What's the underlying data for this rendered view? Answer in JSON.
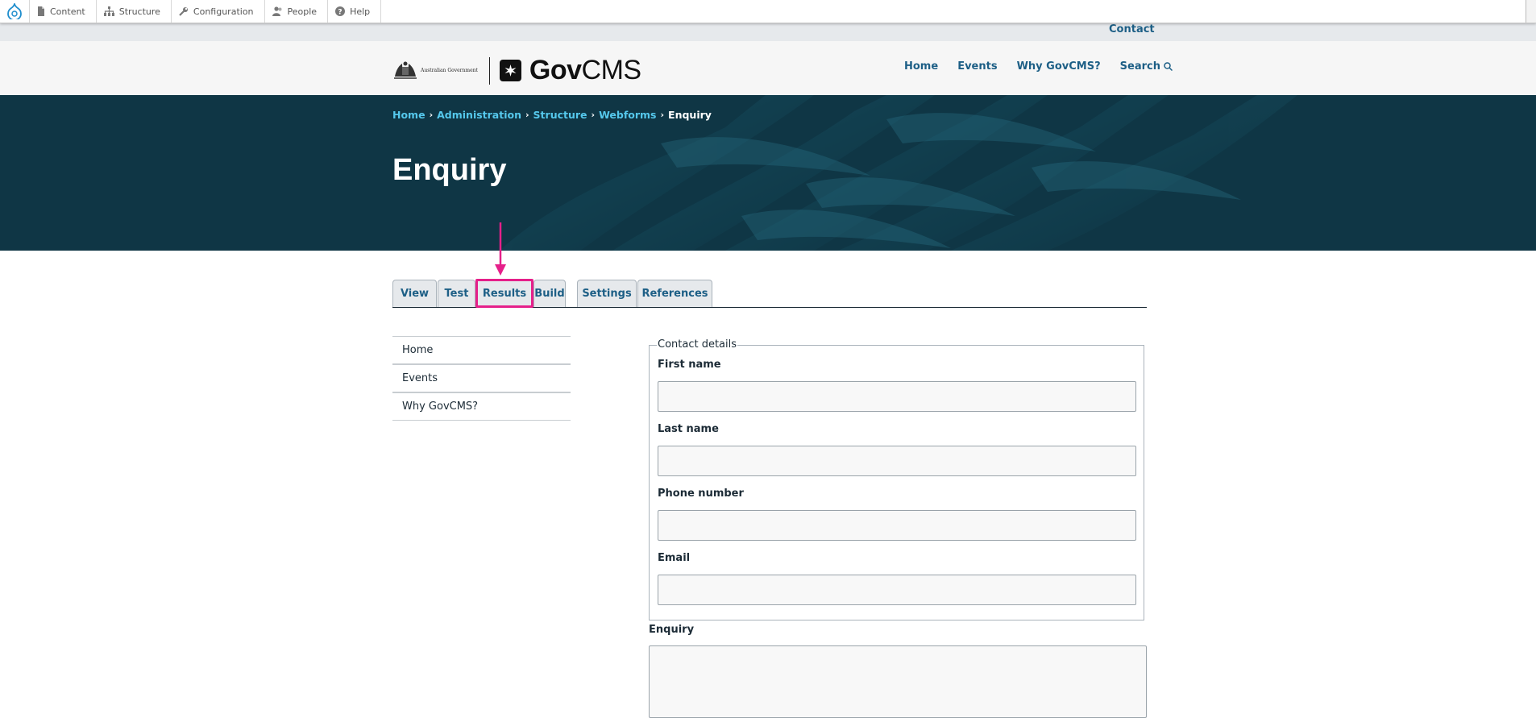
{
  "toolbar": {
    "items": [
      {
        "label": "Content",
        "icon": "document-icon"
      },
      {
        "label": "Structure",
        "icon": "sitemap-icon"
      },
      {
        "label": "Configuration",
        "icon": "wrench-icon"
      },
      {
        "label": "People",
        "icon": "people-icon"
      },
      {
        "label": "Help",
        "icon": "help-icon"
      }
    ]
  },
  "utility": {
    "contact": "Contact"
  },
  "header": {
    "crest_text": "Australian Government",
    "logo_bold": "Gov",
    "logo_light": "CMS",
    "nav": [
      "Home",
      "Events",
      "Why GovCMS?",
      "Search"
    ]
  },
  "breadcrumb": {
    "links": [
      "Home",
      "Administration",
      "Structure",
      "Webforms"
    ],
    "current": "Enquiry"
  },
  "page": {
    "title": "Enquiry"
  },
  "tabs": [
    "View",
    "Test",
    "Results",
    "Build",
    "Settings",
    "References"
  ],
  "highlighted_tab": "Results",
  "sidebar": {
    "items": [
      "Home",
      "Events",
      "Why GovCMS?"
    ]
  },
  "form": {
    "fieldset_legend": "Contact details",
    "fields": [
      {
        "label": "First name",
        "value": ""
      },
      {
        "label": "Last name",
        "value": ""
      },
      {
        "label": "Phone number",
        "value": ""
      },
      {
        "label": "Email",
        "value": ""
      }
    ],
    "enquiry_label": "Enquiry",
    "enquiry_value": ""
  },
  "colors": {
    "link": "#1d5f86",
    "breadcrumb_link": "#55c8ec",
    "hero_bg": "#0f3645",
    "highlight": "#e5208a"
  }
}
